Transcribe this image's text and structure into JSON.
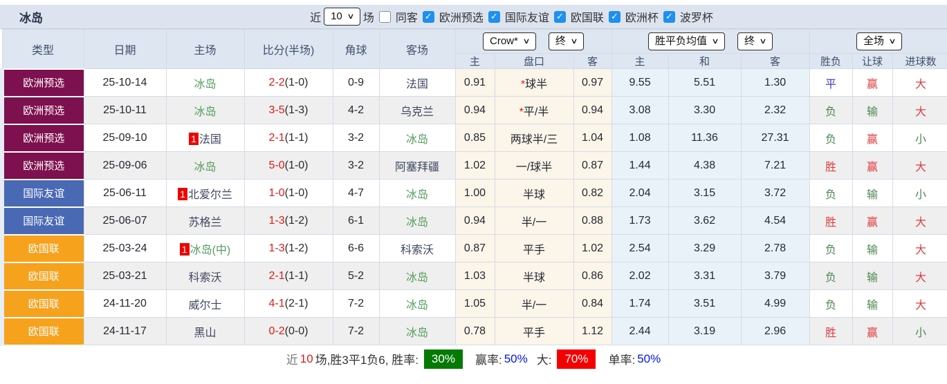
{
  "icons": {
    "chevron_down": "∨",
    "check": "✓"
  },
  "colors": {
    "topbar_bg": "#dde4f0",
    "header_bg": "#dde6f1",
    "type_euro_qualifier": "#7d104e",
    "type_friendly": "#4a69b4",
    "type_nations_league": "#f6a21d",
    "self_team_green": "#539d5b",
    "score_red": "#e31919",
    "result_red": "#dd3c40",
    "result_green": "#4e8751",
    "result_blue": "#3c3ccc",
    "odds_bg_cream": "#fbf5ea",
    "avg_bg_blue": "#e9f2f9",
    "summary_green_badge": "#047a04",
    "summary_red_badge": "#f50000",
    "summary_blue_value": "#0016e6"
  },
  "header_bar": {
    "title": "冰岛",
    "recent_prefix": "近",
    "recent_value": "10",
    "recent_suffix": "场",
    "same_away_label": "同客",
    "same_away_checked": false,
    "filters": [
      {
        "label": "欧洲预选",
        "checked": true
      },
      {
        "label": "国际友谊",
        "checked": true
      },
      {
        "label": "欧国联",
        "checked": true
      },
      {
        "label": "欧洲杯",
        "checked": true
      },
      {
        "label": "波罗杯",
        "checked": true
      }
    ]
  },
  "table": {
    "columns": [
      "类型",
      "日期",
      "主场",
      "比分(半场)",
      "角球",
      "客场"
    ],
    "odds_group": {
      "select1": "Crow*",
      "select2": "终",
      "sub": [
        "主",
        "盘口",
        "客"
      ]
    },
    "avg_group": {
      "select1": "胜平负均值",
      "select2": "终",
      "sub": [
        "主",
        "和",
        "客"
      ]
    },
    "result_group": {
      "select": "全场",
      "sub": [
        "胜负",
        "让球",
        "进球数"
      ]
    },
    "rows": [
      {
        "type": "欧洲预选",
        "type_class": "t-pre",
        "date": "25-10-14",
        "home": "冰岛",
        "home_self": true,
        "home_badge": "",
        "score": "2-2",
        "half": "(1-0)",
        "corners": "0-9",
        "away": "法国",
        "away_self": false,
        "odds_home": "0.91",
        "handicap": "球半",
        "handicap_star": true,
        "odds_away": "0.97",
        "avg_home": "9.55",
        "avg_draw": "5.51",
        "avg_away": "1.30",
        "results": [
          [
            "平",
            "c-blue"
          ],
          [
            "赢",
            "c-red"
          ],
          [
            "大",
            "c-red"
          ]
        ]
      },
      {
        "type": "欧洲预选",
        "type_class": "t-pre",
        "date": "25-10-11",
        "home": "冰岛",
        "home_self": true,
        "home_badge": "",
        "score": "3-5",
        "half": "(1-3)",
        "corners": "4-2",
        "away": "乌克兰",
        "away_self": false,
        "odds_home": "0.94",
        "handicap": "平/半",
        "handicap_star": true,
        "odds_away": "0.94",
        "avg_home": "3.08",
        "avg_draw": "3.30",
        "avg_away": "2.32",
        "results": [
          [
            "负",
            "c-green"
          ],
          [
            "输",
            "c-green"
          ],
          [
            "大",
            "c-red"
          ]
        ]
      },
      {
        "type": "欧洲预选",
        "type_class": "t-pre",
        "date": "25-09-10",
        "home": "法国",
        "home_self": false,
        "home_badge": "1",
        "score": "2-1",
        "half": "(1-1)",
        "corners": "3-2",
        "away": "冰岛",
        "away_self": true,
        "odds_home": "0.85",
        "handicap": "两球半/三",
        "handicap_star": false,
        "odds_away": "1.04",
        "avg_home": "1.08",
        "avg_draw": "11.36",
        "avg_away": "27.31",
        "results": [
          [
            "负",
            "c-green"
          ],
          [
            "赢",
            "c-red"
          ],
          [
            "小",
            "c-green"
          ]
        ]
      },
      {
        "type": "欧洲预选",
        "type_class": "t-pre",
        "date": "25-09-06",
        "home": "冰岛",
        "home_self": true,
        "home_badge": "",
        "score": "5-0",
        "half": "(1-0)",
        "corners": "3-2",
        "away": "阿塞拜疆",
        "away_self": false,
        "odds_home": "1.02",
        "handicap": "一/球半",
        "handicap_star": false,
        "odds_away": "0.87",
        "avg_home": "1.44",
        "avg_draw": "4.38",
        "avg_away": "7.21",
        "results": [
          [
            "胜",
            "c-red"
          ],
          [
            "赢",
            "c-red"
          ],
          [
            "大",
            "c-red"
          ]
        ]
      },
      {
        "type": "国际友谊",
        "type_class": "t-fr",
        "date": "25-06-11",
        "home": "北爱尔兰",
        "home_self": false,
        "home_badge": "1",
        "score": "1-0",
        "half": "(1-0)",
        "corners": "4-7",
        "away": "冰岛",
        "away_self": true,
        "odds_home": "1.00",
        "handicap": "半球",
        "handicap_star": false,
        "odds_away": "0.82",
        "avg_home": "2.04",
        "avg_draw": "3.15",
        "avg_away": "3.72",
        "results": [
          [
            "负",
            "c-green"
          ],
          [
            "输",
            "c-green"
          ],
          [
            "小",
            "c-green"
          ]
        ]
      },
      {
        "type": "国际友谊",
        "type_class": "t-fr",
        "date": "25-06-07",
        "home": "苏格兰",
        "home_self": false,
        "home_badge": "",
        "score": "1-3",
        "half": "(1-2)",
        "corners": "6-1",
        "away": "冰岛",
        "away_self": true,
        "odds_home": "0.94",
        "handicap": "半/一",
        "handicap_star": false,
        "odds_away": "0.88",
        "avg_home": "1.73",
        "avg_draw": "3.62",
        "avg_away": "4.54",
        "results": [
          [
            "胜",
            "c-red"
          ],
          [
            "赢",
            "c-red"
          ],
          [
            "大",
            "c-red"
          ]
        ]
      },
      {
        "type": "欧国联",
        "type_class": "t-na",
        "date": "25-03-24",
        "home": "冰岛(中)",
        "home_self": true,
        "home_badge": "1",
        "score": "1-3",
        "half": "(1-2)",
        "corners": "6-6",
        "away": "科索沃",
        "away_self": false,
        "odds_home": "0.87",
        "handicap": "平手",
        "handicap_star": false,
        "odds_away": "1.02",
        "avg_home": "2.54",
        "avg_draw": "3.29",
        "avg_away": "2.78",
        "results": [
          [
            "负",
            "c-green"
          ],
          [
            "输",
            "c-green"
          ],
          [
            "大",
            "c-red"
          ]
        ]
      },
      {
        "type": "欧国联",
        "type_class": "t-na",
        "date": "25-03-21",
        "home": "科索沃",
        "home_self": false,
        "home_badge": "",
        "score": "2-1",
        "half": "(1-1)",
        "corners": "5-2",
        "away": "冰岛",
        "away_self": true,
        "odds_home": "1.03",
        "handicap": "半球",
        "handicap_star": false,
        "odds_away": "0.86",
        "avg_home": "2.02",
        "avg_draw": "3.31",
        "avg_away": "3.79",
        "results": [
          [
            "负",
            "c-green"
          ],
          [
            "输",
            "c-green"
          ],
          [
            "大",
            "c-red"
          ]
        ]
      },
      {
        "type": "欧国联",
        "type_class": "t-na",
        "date": "24-11-20",
        "home": "威尔士",
        "home_self": false,
        "home_badge": "",
        "score": "4-1",
        "half": "(2-1)",
        "corners": "7-2",
        "away": "冰岛",
        "away_self": true,
        "odds_home": "1.05",
        "handicap": "半/一",
        "handicap_star": false,
        "odds_away": "0.84",
        "avg_home": "1.74",
        "avg_draw": "3.51",
        "avg_away": "4.99",
        "results": [
          [
            "负",
            "c-green"
          ],
          [
            "输",
            "c-green"
          ],
          [
            "大",
            "c-red"
          ]
        ]
      },
      {
        "type": "欧国联",
        "type_class": "t-na",
        "date": "24-11-17",
        "home": "黑山",
        "home_self": false,
        "home_badge": "",
        "score": "0-2",
        "half": "(0-0)",
        "corners": "7-2",
        "away": "冰岛",
        "away_self": true,
        "odds_home": "0.78",
        "handicap": "平手",
        "handicap_star": false,
        "odds_away": "1.12",
        "avg_home": "2.44",
        "avg_draw": "3.19",
        "avg_away": "2.96",
        "results": [
          [
            "胜",
            "c-red"
          ],
          [
            "赢",
            "c-red"
          ],
          [
            "小",
            "c-green"
          ]
        ]
      }
    ]
  },
  "summary": {
    "prefix": "近",
    "count": "10",
    "stats": "场,胜3平1负6, 胜率:",
    "win_rate": "30%",
    "win_label": "赢率:",
    "win_value": "50%",
    "big_label": "大:",
    "big_rate": "70%",
    "single_label": "单率:",
    "single_value": "50%"
  }
}
